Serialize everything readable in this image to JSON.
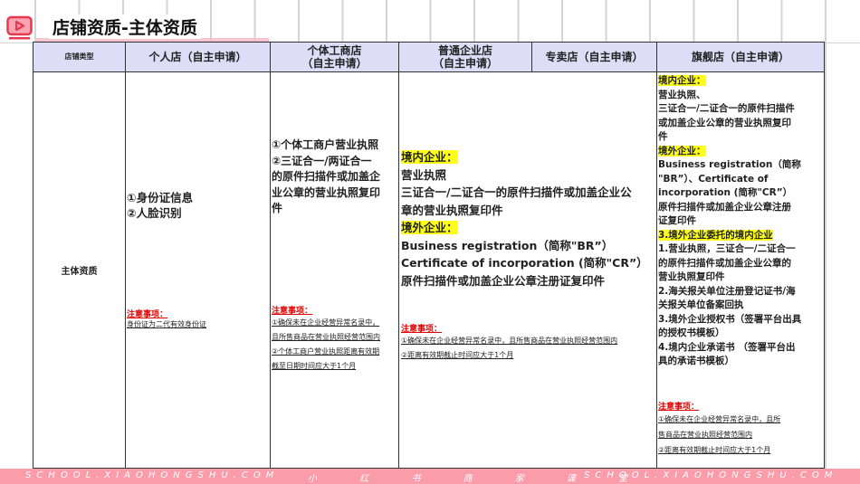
{
  "header": {
    "title": "店铺资质-主体资质",
    "logo": "xiaohongshu-play-icon"
  },
  "colors": {
    "header_bg": "#dedcf6",
    "highlight": "#ffff1a",
    "note_red": "#e00000",
    "footer": "#fb9caa"
  },
  "table": {
    "columns": [
      "店铺类型",
      "个人店（自主申请）",
      "个体工商店\n（自主申请）",
      "普通企业店\n（自主申请）",
      "专卖店（自主申请）",
      "旗舰店（自主申请）"
    ],
    "row_label": "主体资质",
    "personal": {
      "main": "①身份证信息\n②人脸识别",
      "note_title": "注意事项：",
      "note": "身份证为二代有效身份证"
    },
    "individual": {
      "main": "①个体工商户营业执照\n②三证合一/两证合一\n的原件扫描件或加盖企\n业公章的营业执照复印\n件",
      "note_title": "注意事项：",
      "note": "①确保未在企业经营异常名录中，\n且所售商品在营业执照经营范围内\n②个体工商户营业执照距离有效期\n截至日期时间应大于1个月"
    },
    "enterprise": {
      "domestic_h": "境内企业：",
      "domestic": "营业执照\n三证合一/二证合一的原件扫描件或加盖企业公\n章的营业执照复印件",
      "foreign_h": "境外企业：",
      "foreign": "Business registration（简称\"BR”）\nCertificate of incorporation (简称\"CR”）\n原件扫描件或加盖企业公章注册证复印件",
      "note_title": "注意事项：",
      "note": "①确保未在企业经营异常名录中，且所售商品在营业执照经营范围内\n②距离有效期截止时间应大于1个月"
    },
    "flagship": {
      "domestic_h": "境内企业：",
      "domestic": "营业执照、\n三证合一/二证合一的原件扫描件\n或加盖企业公章的营业执照复印\n件",
      "foreign_h": "境外企业：",
      "foreign": "Business registration（简称\n\"BR”）、Certificate of\nincorporation (简称\"CR”）\n原件扫描件或加盖企业公章注册\n证复印件",
      "entrusted_h": "3.境外企业委托的境内企业",
      "entrusted": "1.营业执照，三证合一/二证合一\n的原件扫描件或加盖企业公章的\n营业执照复印件\n2.海关报关单位注册登记证书/海\n关报关单位备案回执\n3.境外企业授权书（签署平台出具\n的授权书模板）\n4.境内企业承诺书 （签署平台出\n具的承诺书模板）",
      "note_title": "注意事项：",
      "note": "①确保未在企业经营异常名录中，且所\n售商品在营业执照经营范围内\n②距离有效期截止时间应大于1个月"
    }
  },
  "footer": {
    "wm_left": "SCHOOL.XIAOHONGSHU.COM",
    "wm_mid": "小 红 书 商 家 课 堂",
    "wm_right": "SCHOOL.XIAOHONGSHU.COM"
  }
}
